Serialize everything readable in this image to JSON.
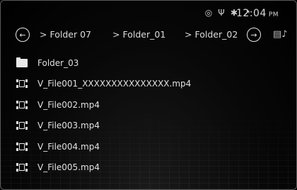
{
  "status_bar": {
    "icons": [
      "disc-icon",
      "usb-icon",
      "bluetooth-icon",
      "signal-icon"
    ],
    "time": "12:04",
    "ampm": "PM"
  },
  "navigation": {
    "back_icon": "arrow-left-icon",
    "forward_icon": "arrow-right-icon",
    "source_icon": "media-source-icon",
    "separator": ">",
    "breadcrumbs": [
      "Folder 07",
      "Folder_01",
      "Folder_02"
    ]
  },
  "file_list": [
    {
      "type": "folder",
      "icon": "folder-icon",
      "name": "Folder_03"
    },
    {
      "type": "video",
      "icon": "film-icon",
      "name": "V_File001_XXXXXXXXXXXXXXX.mp4"
    },
    {
      "type": "video",
      "icon": "film-icon",
      "name": "V_File002.mp4"
    },
    {
      "type": "video",
      "icon": "film-icon",
      "name": "V_File003.mp4"
    },
    {
      "type": "video",
      "icon": "film-icon",
      "name": "V_File004.mp4"
    },
    {
      "type": "video",
      "icon": "film-icon",
      "name": "V_File005.mp4"
    }
  ]
}
